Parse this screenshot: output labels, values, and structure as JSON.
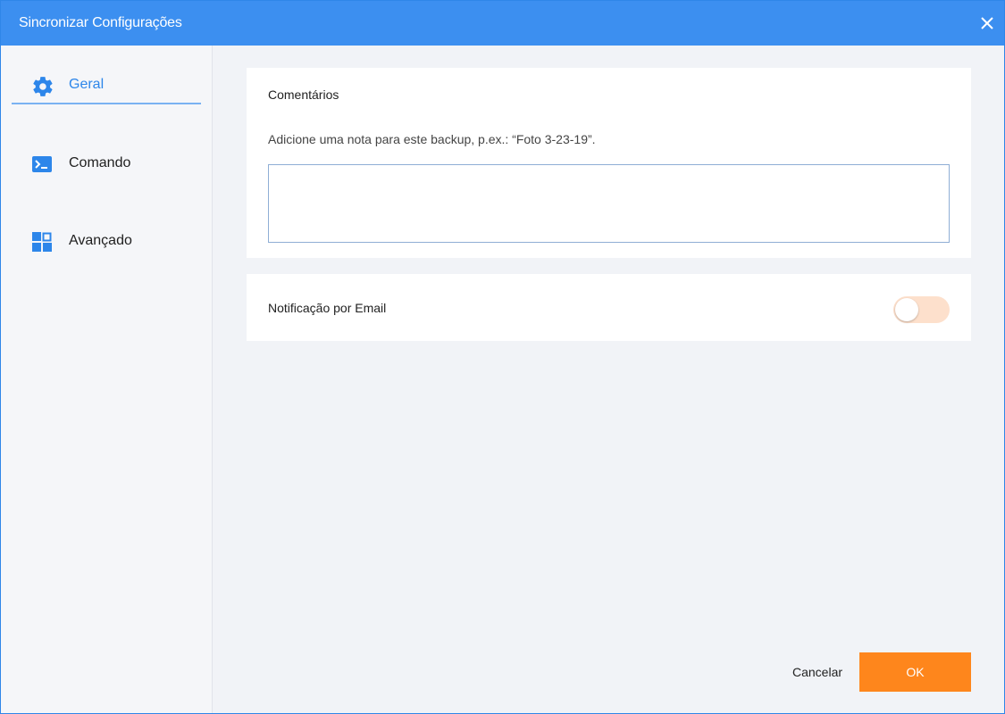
{
  "window": {
    "title": "Sincronizar Configurações",
    "close_icon": "close-icon"
  },
  "sidebar": {
    "items": [
      {
        "label": "Geral",
        "icon": "gear-icon",
        "active": true
      },
      {
        "label": "Comando",
        "icon": "terminal-icon",
        "active": false
      },
      {
        "label": "Avançado",
        "icon": "grid-icon",
        "active": false
      }
    ]
  },
  "comments": {
    "heading": "Comentários",
    "hint": "Adicione uma nota para este backup, p.ex.: “Foto 3-23-19”.",
    "value": "",
    "placeholder": ""
  },
  "email": {
    "label": "Notificação por Email",
    "enabled": false
  },
  "footer": {
    "cancel_label": "Cancelar",
    "ok_label": "OK"
  },
  "colors": {
    "titlebar": "#3c8ff0",
    "accent": "#2d86ea",
    "ok_button": "#fe861c",
    "toggle_off": "#fde0cc"
  }
}
